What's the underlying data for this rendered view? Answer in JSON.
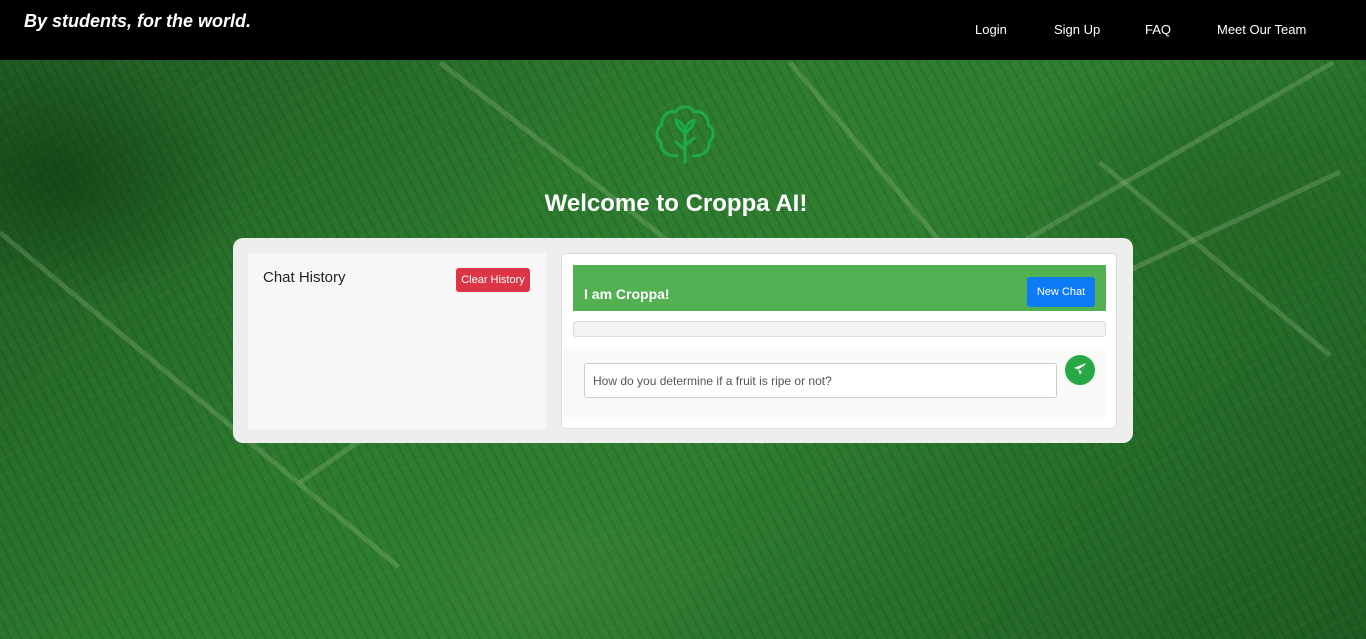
{
  "header": {
    "tagline": "By students, for the world.",
    "nav": [
      {
        "label": "Login"
      },
      {
        "label": "Sign Up"
      },
      {
        "label": "FAQ"
      },
      {
        "label": "Meet Our Team"
      }
    ]
  },
  "hero": {
    "logo_icon": "tree-brain-icon",
    "title": "Welcome to Croppa AI!"
  },
  "history": {
    "title": "Chat History",
    "clear_label": "Clear History"
  },
  "chat": {
    "header_title": "I am Croppa!",
    "new_chat_label": "New Chat",
    "input_placeholder": "How do you determine if a fruit is ripe or not?",
    "input_value": "",
    "send_icon": "paper-plane-icon"
  },
  "colors": {
    "topbar": "#000000",
    "chat_header": "#53b153",
    "clear_button": "#dc3545",
    "new_chat_button": "#0d7bf5",
    "send_button": "#28a745",
    "logo": "#1faa4a"
  }
}
